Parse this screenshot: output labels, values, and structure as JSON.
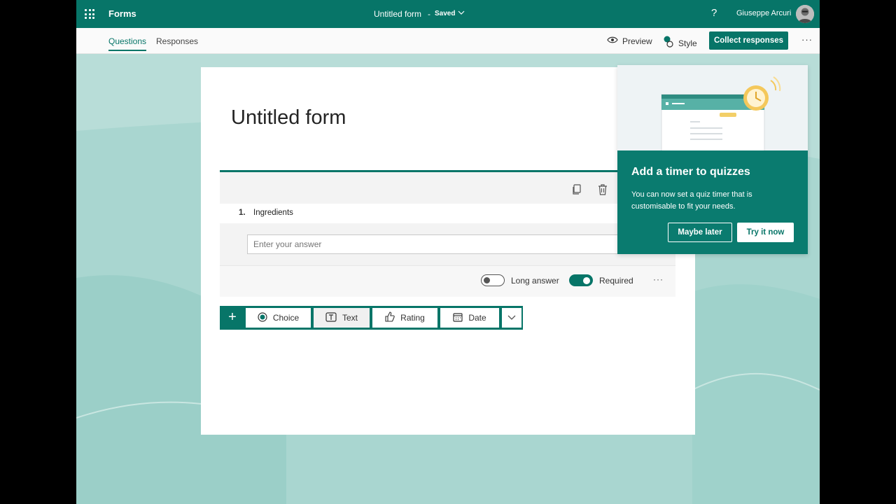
{
  "topbar": {
    "app_name": "Forms",
    "doc_title": "Untitled form",
    "doc_separator": "-",
    "doc_status": "Saved",
    "help": "?",
    "user_name": "Giuseppe Arcuri"
  },
  "subbar": {
    "tabs": [
      {
        "label": "Questions",
        "active": true
      },
      {
        "label": "Responses",
        "active": false
      }
    ],
    "preview_label": "Preview",
    "style_label": "Style",
    "collect_label": "Collect responses",
    "more": "···"
  },
  "form": {
    "title": "Untitled form",
    "question": {
      "number": "1.",
      "label": "Ingredients",
      "placeholder": "Enter your answer",
      "long_answer_label": "Long answer",
      "long_answer_on": false,
      "required_label": "Required",
      "required_on": true,
      "more": "···"
    },
    "add_bar": {
      "plus": "+",
      "types": [
        {
          "label": "Choice",
          "icon": "radio-icon"
        },
        {
          "label": "Text",
          "icon": "text-icon"
        },
        {
          "label": "Rating",
          "icon": "thumb-icon"
        },
        {
          "label": "Date",
          "icon": "calendar-icon"
        }
      ]
    }
  },
  "popup": {
    "title": "Add a timer to quizzes",
    "text": "You can now set a quiz timer that is customisable to fit your needs.",
    "later_label": "Maybe later",
    "try_label": "Try it now"
  },
  "colors": {
    "brand": "#077568",
    "background": "#a9d6d0"
  }
}
